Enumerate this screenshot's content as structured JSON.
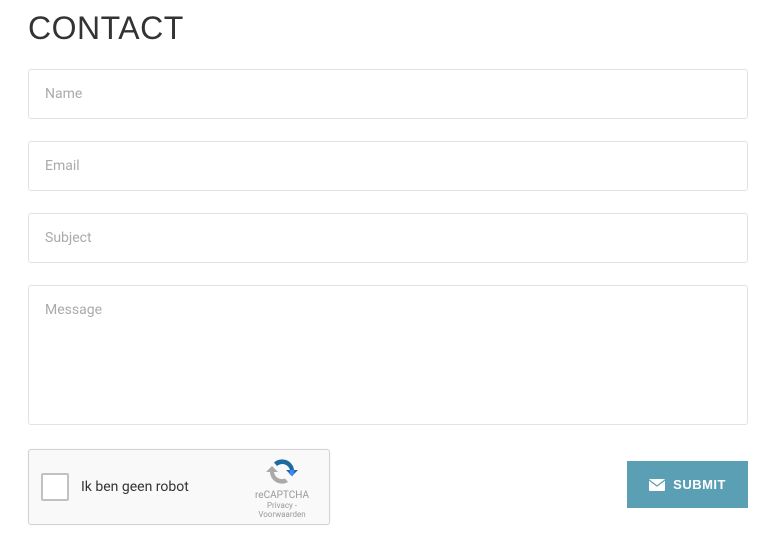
{
  "title": "CONTACT",
  "form": {
    "name": {
      "placeholder": "Name",
      "value": ""
    },
    "email": {
      "placeholder": "Email",
      "value": ""
    },
    "subject": {
      "placeholder": "Subject",
      "value": ""
    },
    "message": {
      "placeholder": "Message",
      "value": ""
    }
  },
  "recaptcha": {
    "label": "Ik ben geen robot",
    "brand": "reCAPTCHA",
    "links": "Privacy - Voorwaarden"
  },
  "submit": {
    "label": "SUBMIT"
  }
}
